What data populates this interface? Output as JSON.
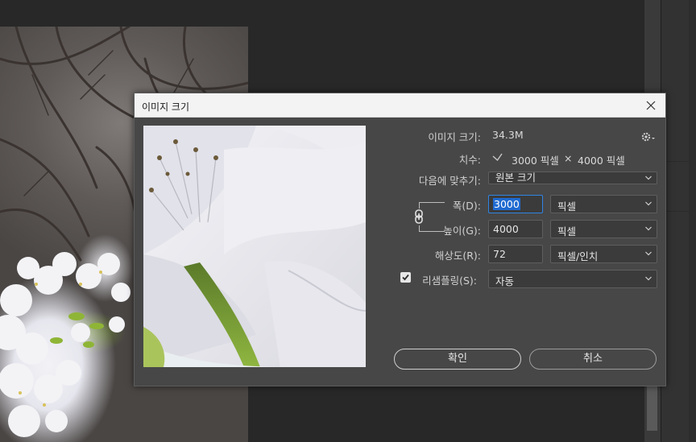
{
  "dialog": {
    "title": "이미지 크기",
    "image_size_label": "이미지 크기:",
    "image_size_value": "34.3M",
    "dimensions_label": "치수:",
    "dimensions_width": "3000 픽셀",
    "dimensions_times": "×",
    "dimensions_height": "4000 픽셀",
    "fit_to_label": "다음에 맞추기:",
    "fit_to_value": "원본 크기",
    "width_label": "폭(D):",
    "width_value": "3000",
    "width_unit": "픽셀",
    "height_label": "높이(G):",
    "height_value": "4000",
    "height_unit": "픽셀",
    "resolution_label": "해상도(R):",
    "resolution_value": "72",
    "resolution_unit": "픽셀/인치",
    "resample_label": "리샘플링(S):",
    "resample_value": "자동",
    "ok_label": "확인",
    "cancel_label": "취소"
  },
  "colors": {
    "dialog_bg": "#474747",
    "field_bg": "#3b3b3b",
    "focus_border": "#2f84e4",
    "selection": "#1f6ad0",
    "titlebar_bg": "#f3f3f3"
  },
  "icons": {
    "close": "close-icon",
    "gear": "gear-icon",
    "chain": "chain-link-icon",
    "chevron": "chevron-down-icon",
    "check": "checkmark-icon"
  }
}
